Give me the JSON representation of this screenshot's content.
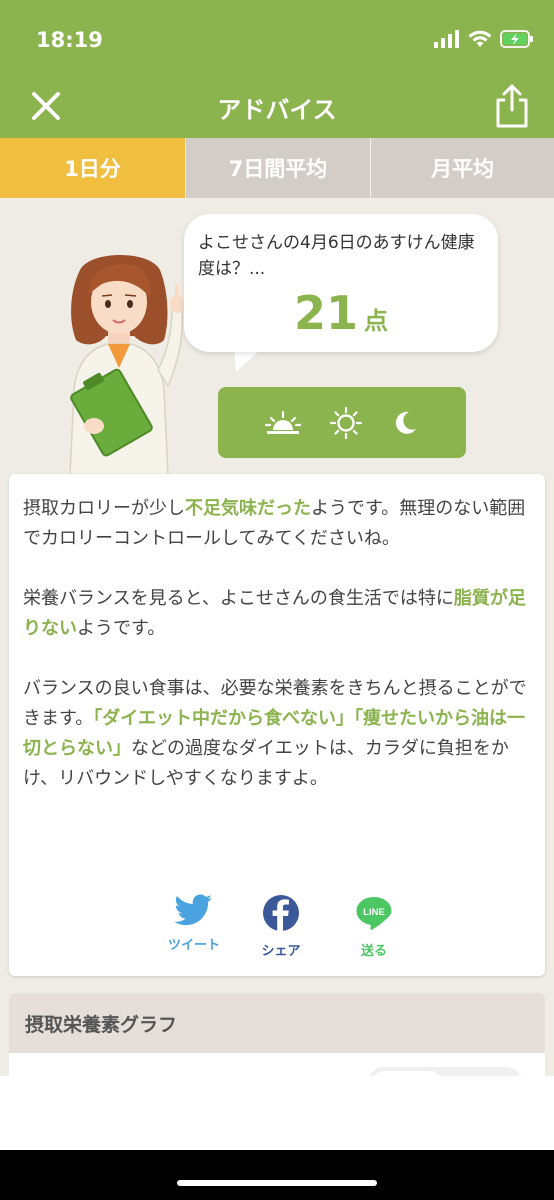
{
  "status": {
    "time": "18:19",
    "icons": [
      "signal-icon",
      "wifi-icon",
      "battery-charging-icon"
    ]
  },
  "header": {
    "title": "アドバイス",
    "close_icon": "close-icon",
    "share_icon": "share-icon"
  },
  "tabs": [
    {
      "label": "1日分",
      "active": true
    },
    {
      "label": "7日間平均",
      "active": false
    },
    {
      "label": "月平均",
      "active": false
    }
  ],
  "bubble": {
    "text": "よこせさんの4月6日のあすけん健康度は？...",
    "score": "21",
    "unit": "点"
  },
  "time_of_day_icons": [
    "sunrise-icon",
    "sun-icon",
    "moon-icon"
  ],
  "advice": {
    "p1_a": "摂取カロリーが少し",
    "p1_hl": "不足気味だった",
    "p1_b": "ようです。無理のない範囲でカロリーコントロールしてみてくださいね。",
    "p2_a": "栄養バランスを見ると、よこせさんの食生活では特に",
    "p2_hl": "脂質が足りない",
    "p2_b": "ようです。",
    "p3_a": "バランスの良い食事は、必要な栄養素をきちんと摂ることができます。",
    "p3_hl1": "「ダイエット中だから食べない」",
    "p3_hl2": "「痩せたいから油は一切とらない」",
    "p3_b": "などの過度なダイエットは、カラダに負担をかけ、リバウンドしやすくなりますよ。"
  },
  "share": {
    "twitter": "ツイート",
    "facebook": "シェア",
    "line": "送る",
    "line_logo_text": "LINE"
  },
  "graph": {
    "title": "摂取栄養素グラフ"
  },
  "colors": {
    "brand_green": "#8bb34e",
    "tab_active": "#f1bf3f",
    "tab_inactive": "#d4cdc7",
    "twitter": "#4aa3df",
    "facebook": "#3b5998",
    "line": "#4cc764"
  }
}
